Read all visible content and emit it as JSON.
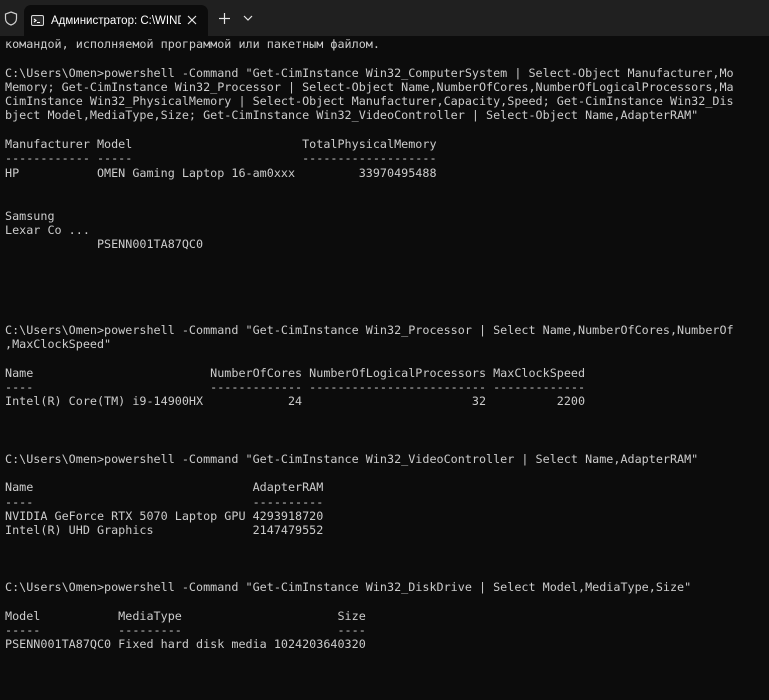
{
  "window": {
    "tab_title": "Администратор: C:\\WINDOW",
    "icons": {
      "shield": "shield-icon",
      "terminal": "terminal-icon",
      "close": "close-icon",
      "new_tab": "plus-icon",
      "dropdown": "chevron-down-icon"
    },
    "colors": {
      "background": "#0c0c0c",
      "titlebar": "#202020",
      "text": "#cccccc"
    }
  },
  "console": {
    "lines": [
      "командой, исполняемой программой или пакетным файлом.",
      "",
      "C:\\Users\\Omen>powershell -Command \"Get-CimInstance Win32_ComputerSystem | Select-Object Manufacturer,Mo",
      "Memory; Get-CimInstance Win32_Processor | Select-Object Name,NumberOfCores,NumberOfLogicalProcessors,Ma",
      "CimInstance Win32_PhysicalMemory | Select-Object Manufacturer,Capacity,Speed; Get-CimInstance Win32_Dis",
      "bject Model,MediaType,Size; Get-CimInstance Win32_VideoController | Select-Object Name,AdapterRAM\"",
      "",
      "Manufacturer Model                        TotalPhysicalMemory",
      "------------ -----                        -------------------",
      "HP           OMEN Gaming Laptop 16-am0xxx         33970495488",
      "",
      "",
      "Samsung",
      "Lexar Co ...",
      "             PSENN001TA87QC0",
      "",
      "",
      "",
      "",
      "",
      "C:\\Users\\Omen>powershell -Command \"Get-CimInstance Win32_Processor | Select Name,NumberOfCores,NumberOf",
      ",MaxClockSpeed\"",
      "",
      "Name                         NumberOfCores NumberOfLogicalProcessors MaxClockSpeed",
      "----                         ------------- ------------------------- -------------",
      "Intel(R) Core(TM) i9-14900HX            24                        32          2200",
      "",
      "",
      "",
      "C:\\Users\\Omen>powershell -Command \"Get-CimInstance Win32_VideoController | Select Name,AdapterRAM\"",
      "",
      "Name                               AdapterRAM",
      "----                               ----------",
      "NVIDIA GeForce RTX 5070 Laptop GPU 4293918720",
      "Intel(R) UHD Graphics              2147479552",
      "",
      "",
      "",
      "C:\\Users\\Omen>powershell -Command \"Get-CimInstance Win32_DiskDrive | Select Model,MediaType,Size\"",
      "",
      "Model           MediaType                      Size",
      "-----           ---------                      ----",
      "PSENN001TA87QC0 Fixed hard disk media 1024203640320",
      "",
      "",
      "",
      ""
    ],
    "prompt": "C:\\Users\\Omen>"
  }
}
